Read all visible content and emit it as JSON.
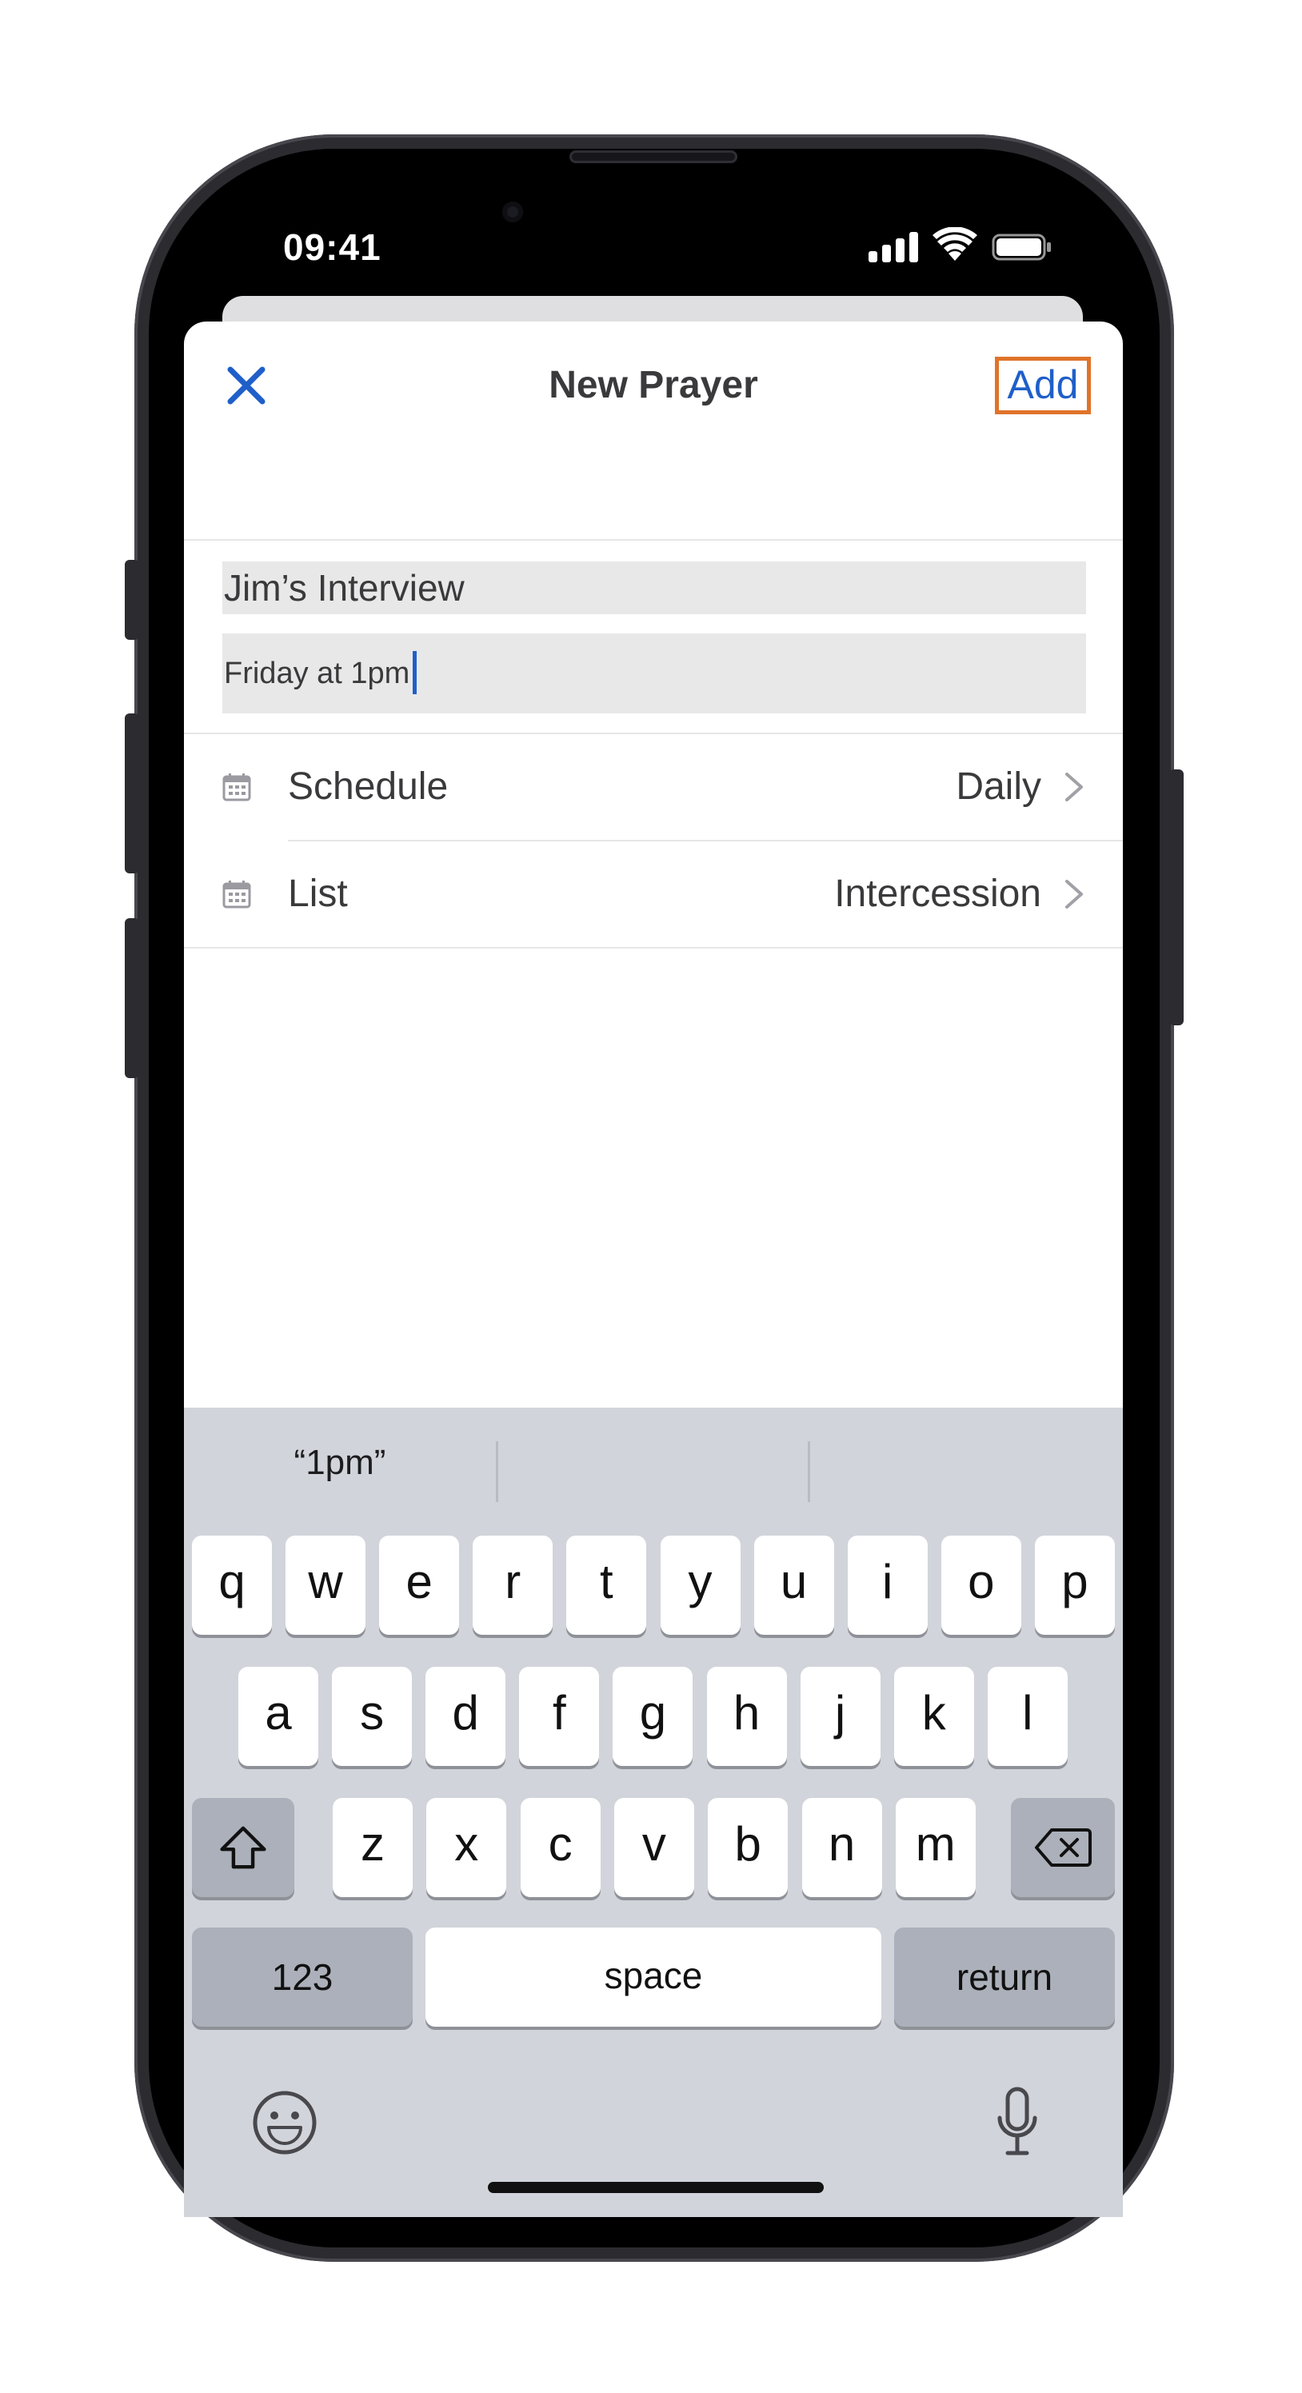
{
  "status_bar": {
    "time": "09:41"
  },
  "header": {
    "title": "New Prayer",
    "add_label": "Add"
  },
  "form": {
    "title_value": "Jim’s Interview",
    "notes_value": "Friday at 1pm"
  },
  "rows": [
    {
      "label": "Schedule",
      "value": "Daily"
    },
    {
      "label": "List",
      "value": "Intercession"
    }
  ],
  "keyboard": {
    "suggestions": [
      "“1pm”",
      "",
      ""
    ],
    "row1": [
      "q",
      "w",
      "e",
      "r",
      "t",
      "y",
      "u",
      "i",
      "o",
      "p"
    ],
    "row2": [
      "a",
      "s",
      "d",
      "f",
      "g",
      "h",
      "j",
      "k",
      "l"
    ],
    "row3": [
      "z",
      "x",
      "c",
      "v",
      "b",
      "n",
      "m"
    ],
    "numbers_label": "123",
    "space_label": "space",
    "return_label": "return"
  },
  "icons": {
    "close": "close-icon",
    "calendar": "calendar-icon",
    "chevron": "chevron-right-icon",
    "shift": "shift-icon",
    "delete": "delete-icon",
    "emoji": "emoji-icon",
    "mic": "microphone-icon"
  },
  "colors": {
    "accent": "#1f5fc9",
    "highlight": "#e0732a",
    "keyboard_bg": "#d1d4da"
  }
}
